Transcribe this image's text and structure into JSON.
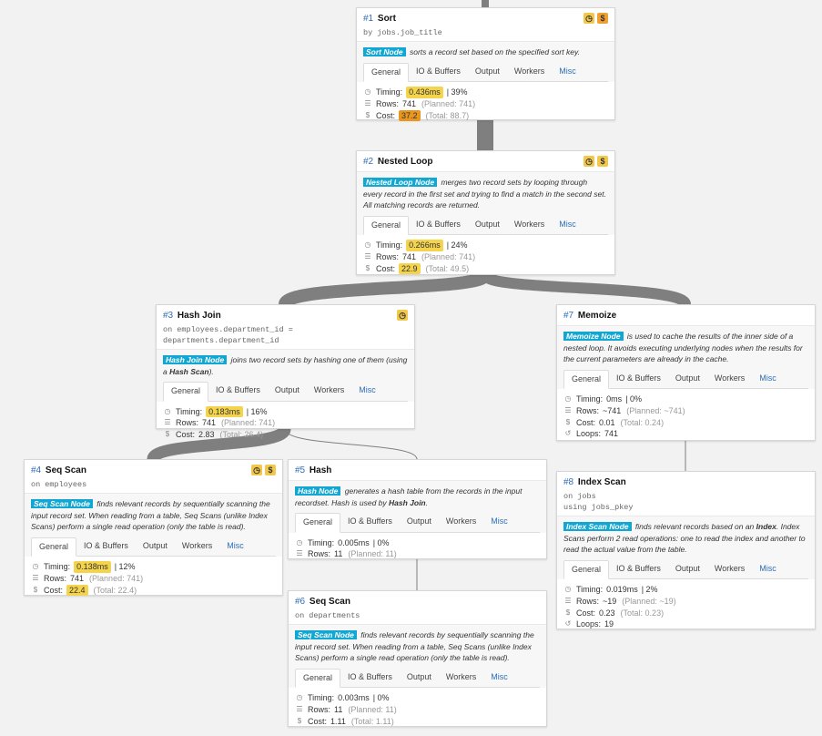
{
  "nodes": {
    "n1": {
      "id": "#1",
      "title": "Sort",
      "subtitle": "by jobs.job_title",
      "type_label": "Sort Node",
      "desc": "sorts a record set based on the specified sort key.",
      "tabs": [
        "General",
        "IO & Buffers",
        "Output",
        "Workers",
        "Misc"
      ],
      "timing_label": "Timing:",
      "timing": "0.436ms",
      "timing_pct": "| 39%",
      "rows_label": "Rows:",
      "rows": "741",
      "rows_planned": "(Planned: 741)",
      "cost_label": "Cost:",
      "cost": "37.2",
      "cost_total": "(Total: 88.7)"
    },
    "n2": {
      "id": "#2",
      "title": "Nested Loop",
      "type_label": "Nested Loop Node",
      "desc": "merges two record sets by looping through every record in the first set and trying to find a match in the second set. All matching records are returned.",
      "tabs": [
        "General",
        "IO & Buffers",
        "Output",
        "Workers",
        "Misc"
      ],
      "timing_label": "Timing:",
      "timing": "0.266ms",
      "timing_pct": "| 24%",
      "rows_label": "Rows:",
      "rows": "741",
      "rows_planned": "(Planned: 741)",
      "cost_label": "Cost:",
      "cost": "22.9",
      "cost_total": "(Total: 49.5)"
    },
    "n3": {
      "id": "#3",
      "title": "Hash Join",
      "subtitle": "on employees.department_id = departments.department_id",
      "type_label": "Hash Join Node",
      "desc_a": "joins two record sets by hashing one of them (using a ",
      "desc_b": "Hash Scan",
      "desc_c": ").",
      "tabs": [
        "General",
        "IO & Buffers",
        "Output",
        "Workers",
        "Misc"
      ],
      "timing_label": "Timing:",
      "timing": "0.183ms",
      "timing_pct": "| 16%",
      "rows_label": "Rows:",
      "rows": "741",
      "rows_planned": "(Planned: 741)",
      "cost_label": "Cost:",
      "cost": "2.83",
      "cost_total": "(Total: 26.4)"
    },
    "n4": {
      "id": "#4",
      "title": "Seq Scan",
      "subtitle": "on employees",
      "type_label": "Seq Scan Node",
      "desc": "finds relevant records by sequentially scanning the input record set. When reading from a table, Seq Scans (unlike Index Scans) perform a single read operation (only the table is read).",
      "tabs": [
        "General",
        "IO & Buffers",
        "Output",
        "Workers",
        "Misc"
      ],
      "timing_label": "Timing:",
      "timing": "0.138ms",
      "timing_pct": "| 12%",
      "rows_label": "Rows:",
      "rows": "741",
      "rows_planned": "(Planned: 741)",
      "cost_label": "Cost:",
      "cost": "22.4",
      "cost_total": "(Total: 22.4)"
    },
    "n5": {
      "id": "#5",
      "title": "Hash",
      "type_label": "Hash Node",
      "desc_a": "generates a hash table from the records in the input recordset. Hash is used by ",
      "desc_b": "Hash Join",
      "desc_c": ".",
      "tabs": [
        "General",
        "IO & Buffers",
        "Output",
        "Workers",
        "Misc"
      ],
      "timing_label": "Timing:",
      "timing": "0.005ms",
      "timing_pct": "| 0%",
      "rows_label": "Rows:",
      "rows": "11",
      "rows_planned": "(Planned: 11)"
    },
    "n6": {
      "id": "#6",
      "title": "Seq Scan",
      "subtitle": "on departments",
      "type_label": "Seq Scan Node",
      "desc": "finds relevant records by sequentially scanning the input record set. When reading from a table, Seq Scans (unlike Index Scans) perform a single read operation (only the table is read).",
      "tabs": [
        "General",
        "IO & Buffers",
        "Output",
        "Workers",
        "Misc"
      ],
      "timing_label": "Timing:",
      "timing": "0.003ms",
      "timing_pct": "| 0%",
      "rows_label": "Rows:",
      "rows": "11",
      "rows_planned": "(Planned: 11)",
      "cost_label": "Cost:",
      "cost": "1.11",
      "cost_total": "(Total: 1.11)"
    },
    "n7": {
      "id": "#7",
      "title": "Memoize",
      "type_label": "Memoize Node",
      "desc": "is used to cache the results of the inner side of a nested loop. It avoids executing underlying nodes when the results for the current parameters are already in the cache.",
      "tabs": [
        "General",
        "IO & Buffers",
        "Output",
        "Workers",
        "Misc"
      ],
      "timing_label": "Timing:",
      "timing": "0ms",
      "timing_pct": "| 0%",
      "rows_label": "Rows:",
      "rows": "~741",
      "rows_planned": "(Planned: ~741)",
      "cost_label": "Cost:",
      "cost": "0.01",
      "cost_total": "(Total: 0.24)",
      "loops_label": "Loops:",
      "loops": "741"
    },
    "n8": {
      "id": "#8",
      "title": "Index Scan",
      "subtitle": "on jobs",
      "subtitle2": "using jobs_pkey",
      "type_label": "Index Scan Node",
      "desc_a": "finds relevant records based on an ",
      "desc_b": "Index",
      "desc_c": ". Index Scans perform 2 read operations: one to read the index and another to read the actual value from the table.",
      "tabs": [
        "General",
        "IO & Buffers",
        "Output",
        "Workers",
        "Misc"
      ],
      "timing_label": "Timing:",
      "timing": "0.019ms",
      "timing_pct": "| 2%",
      "rows_label": "Rows:",
      "rows": "~19",
      "rows_planned": "(Planned: ~19)",
      "cost_label": "Cost:",
      "cost": "0.23",
      "cost_total": "(Total: 0.23)",
      "loops_label": "Loops:",
      "loops": "19"
    }
  },
  "icons": {
    "clock": "clock-icon",
    "cost": "dollar-icon",
    "rows": "rows-icon",
    "loops": "loop-icon"
  },
  "colors": {
    "node_type": "#12a7d3",
    "highlight": "#f5d44d",
    "highlight_strong": "#e8961e",
    "edge": "#7f7f7f"
  }
}
